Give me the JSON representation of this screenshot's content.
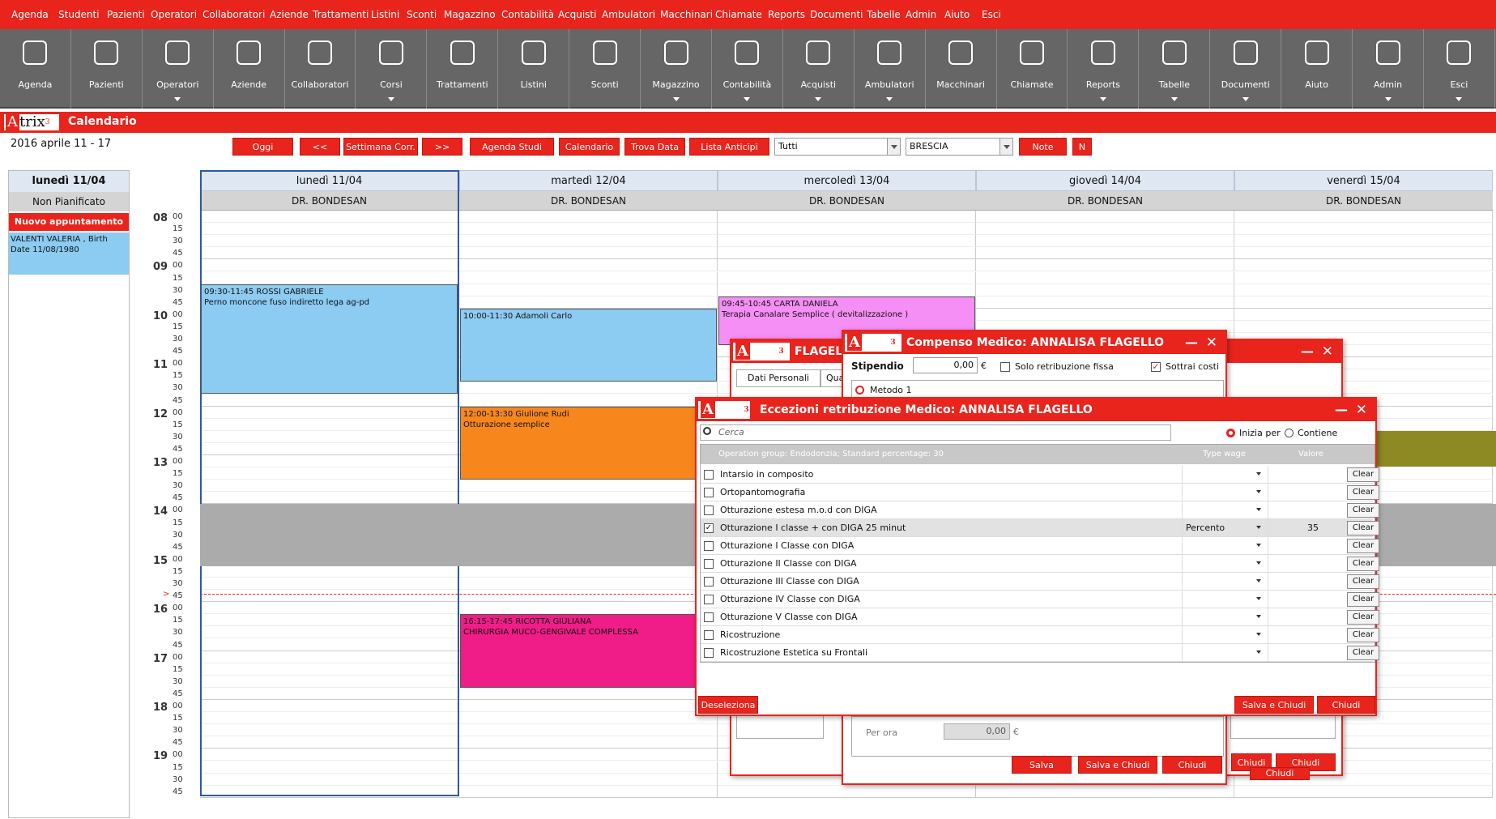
{
  "menu": [
    "Agenda",
    "Studenti",
    "Pazienti",
    "Operatori",
    "Collaboratori",
    "Aziende",
    "Trattamenti",
    "Listini",
    "Sconti",
    "Magazzino",
    "Contabilità",
    "Acquisti",
    "Ambulatori",
    "Macchinari",
    "Chiamate",
    "Reports",
    "Documenti",
    "Tabelle",
    "Admin",
    "Aiuto",
    "Esci"
  ],
  "toolbar": [
    {
      "label": "Agenda",
      "icon": "agenda-icon",
      "arrow": false
    },
    {
      "label": "Pazienti",
      "icon": "patients-icon",
      "arrow": false
    },
    {
      "label": "Operatori",
      "icon": "operators-icon",
      "arrow": true
    },
    {
      "label": "Aziende",
      "icon": "briefcase-icon",
      "arrow": false
    },
    {
      "label": "Collaboratori",
      "icon": "collaborators-icon",
      "arrow": false
    },
    {
      "label": "Corsi",
      "icon": "books-icon",
      "arrow": true
    },
    {
      "label": "Trattamenti",
      "icon": "treatment-icon",
      "arrow": false
    },
    {
      "label": "Listini",
      "icon": "pricelist-icon",
      "arrow": false
    },
    {
      "label": "Sconti",
      "icon": "discount-icon",
      "arrow": false
    },
    {
      "label": "Magazzino",
      "icon": "warehouse-icon",
      "arrow": true
    },
    {
      "label": "Contabilità",
      "icon": "coins-icon",
      "arrow": true
    },
    {
      "label": "Acquisti",
      "icon": "cart-icon",
      "arrow": true
    },
    {
      "label": "Ambulatori",
      "icon": "clinic-icon",
      "arrow": true
    },
    {
      "label": "Macchinari",
      "icon": "gear-wheel-icon",
      "arrow": false
    },
    {
      "label": "Chiamate",
      "icon": "phone-icon",
      "arrow": false
    },
    {
      "label": "Reports",
      "icon": "reports-icon",
      "arrow": true
    },
    {
      "label": "Tabelle",
      "icon": "tables-icon",
      "arrow": true
    },
    {
      "label": "Documenti",
      "icon": "documents-icon",
      "arrow": true
    },
    {
      "label": "Aiuto",
      "icon": "help-book-icon",
      "arrow": false
    },
    {
      "label": "Admin",
      "icon": "admin-gear-icon",
      "arrow": true
    },
    {
      "label": "Esci",
      "icon": "exit-icon",
      "arrow": true
    }
  ],
  "header": {
    "logo": "Atrix",
    "logo_sup": "3",
    "title": "Calendario",
    "range": "2016 aprile 11 - 17"
  },
  "nav": {
    "oggi": "Oggi",
    "prev": "<<",
    "settimana": "Settimana Corr.",
    "next": ">>",
    "agenda_studi": "Agenda Studi",
    "calendario": "Calendario",
    "trova": "Trova Data",
    "lista": "Lista Anticipi",
    "filter1": "Tutti",
    "filter2": "BRESCIA",
    "note": "Note",
    "n": "N"
  },
  "side": {
    "day": "lunedì 11/04",
    "np": "Non Pianificato",
    "nuovo": "Nuovo appuntamento",
    "patient": "VALENTI VALERIA , Birth Date 11/08/1980"
  },
  "days": [
    {
      "label": "lunedì 11/04",
      "doctor": "DR. BONDESAN"
    },
    {
      "label": "martedì 12/04",
      "doctor": "DR. BONDESAN"
    },
    {
      "label": "mercoledì 13/04",
      "doctor": "DR. BONDESAN"
    },
    {
      "label": "giovedì 14/04",
      "doctor": "DR. BONDESAN"
    },
    {
      "label": "venerdì 15/04",
      "doctor": "DR. BONDESAN"
    }
  ],
  "hours": [
    "08",
    "09",
    "10",
    "11",
    "12",
    "13",
    "14",
    "15",
    "16",
    "17",
    "18",
    "19"
  ],
  "quarters": [
    "00",
    "15",
    "30",
    "45"
  ],
  "now_marker": ">",
  "appointments": [
    {
      "time": "09:30-11:45 ROSSI GABRIELE",
      "desc": "Perno moncone fuso indiretto lega ag-pd",
      "color": "#8ccbf2"
    },
    {
      "time": "10:00-11:30 Adamoli Carlo",
      "desc": "",
      "color": "#8ccbf2"
    },
    {
      "time": "09:45-10:45 CARTA DANIELA",
      "desc": "Terapia Canalare Semplice ( devitalizzazione )",
      "color": "#f58ff5"
    },
    {
      "time": "12:00-13:30 Giulione Rudi",
      "desc": "Otturazione semplice",
      "color": "#f7871d"
    },
    {
      "time": "16:15-17:45 RICOTTA GIULIANA",
      "desc": "CHIRURGIA MUCO-GENGIVALE COMPLESSA",
      "color": "#f01c88"
    }
  ],
  "win_back": {
    "title": "FLAGELLO",
    "tab1": "Dati Personali",
    "tab2": "Qua",
    "chiudi1": "Chiudi",
    "chiudi2": "Chiudi",
    "chiudi3": "Chiudi"
  },
  "win_compenso": {
    "title": "Compenso Medico: ANNALISA FLAGELLO",
    "stipendio": "Stipendio",
    "stip_val": "0,00",
    "euro": "€",
    "solo": "Solo retribuzione fissa",
    "sottrai": "Sottrai costi",
    "metodo": "Metodo 1",
    "per_ora": "Per ora",
    "per_ora_val": "0,00",
    "salva": "Salva",
    "salva_chiudi": "Salva e Chiudi",
    "chiudi": "Chiudi"
  },
  "win_ecc": {
    "title": "Eccezioni retribuzione Medico: ANNALISA FLAGELLO",
    "search_ph": "Cerca",
    "inizia": "Inizia per",
    "contiene": "Contiene",
    "group": "Operation group: Endodonzia; Standard percentage: 30",
    "col_type": "Type wage",
    "col_val": "Valore",
    "clear": "Clear",
    "rows": [
      {
        "name": "Intarsio in composito",
        "checked": false,
        "type": "",
        "value": ""
      },
      {
        "name": "Ortopantomografia",
        "checked": false,
        "type": "",
        "value": ""
      },
      {
        "name": "Otturazione estesa m.o.d con DIGA",
        "checked": false,
        "type": "",
        "value": ""
      },
      {
        "name": "Otturazione I classe + con DIGA  25 minut",
        "checked": true,
        "type": "Percento",
        "value": "35"
      },
      {
        "name": "Otturazione I Classe con DIGA",
        "checked": false,
        "type": "",
        "value": ""
      },
      {
        "name": "Otturazione II Classe con DIGA",
        "checked": false,
        "type": "",
        "value": ""
      },
      {
        "name": "Otturazione III Classe con DIGA",
        "checked": false,
        "type": "",
        "value": ""
      },
      {
        "name": "Otturazione IV Classe con DIGA",
        "checked": false,
        "type": "",
        "value": ""
      },
      {
        "name": "Otturazione V Classe con DIGA",
        "checked": false,
        "type": "",
        "value": ""
      },
      {
        "name": "Ricostruzione",
        "checked": false,
        "type": "",
        "value": ""
      },
      {
        "name": "Ricostruzione Estetica su Frontali",
        "checked": false,
        "type": "",
        "value": ""
      }
    ],
    "deseleziona": "Deseleziona",
    "salva_chiudi": "Salva e Chiudi",
    "chiudi": "Chiudi"
  },
  "colors": {
    "accent": "#e8241c",
    "toolbar": "#666666",
    "olive": "#8d8a24"
  }
}
